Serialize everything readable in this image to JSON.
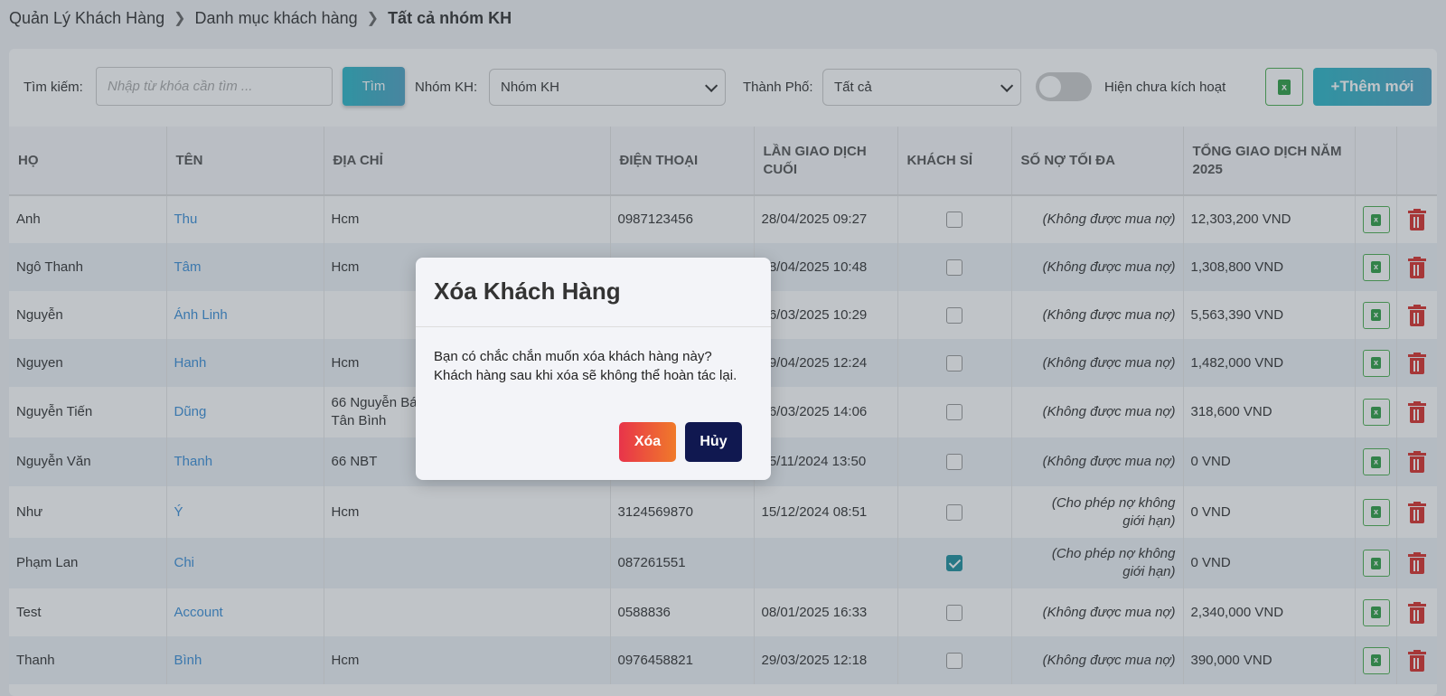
{
  "breadcrumb": {
    "items": [
      "Quản Lý Khách Hàng",
      "Danh mục khách hàng"
    ],
    "current": "Tất cả nhóm KH"
  },
  "filters": {
    "search_label": "Tìm kiếm:",
    "search_placeholder": "Nhập từ khóa cần tìm ...",
    "search_button": "Tìm",
    "group_label": "Nhóm KH:",
    "group_value": "Nhóm KH",
    "city_label": "Thành Phố:",
    "city_value": "Tất cả",
    "show_inactive_label": "Hiện chưa kích hoạt",
    "show_inactive_on": false,
    "add_button": "+Thêm mới"
  },
  "table": {
    "headers": [
      "HỌ",
      "TÊN",
      "ĐỊA CHỈ",
      "ĐIỆN THOẠI",
      "LẦN GIAO DỊCH CUỐI",
      "KHÁCH SỈ",
      "SỐ NỢ TỐI ĐA",
      "TỔNG GIAO DỊCH NĂM 2025",
      "",
      ""
    ],
    "rows": [
      {
        "ho": "Anh",
        "ten": "Thu",
        "dia_chi": "Hcm",
        "dien_thoai": "0987123456",
        "gd_cuoi": "28/04/2025 09:27",
        "khach_si": false,
        "no_toi_da": "(Không được mua nợ)",
        "tong_gd": "12,303,200 VND"
      },
      {
        "ho": "Ngô Thanh",
        "ten": "Tâm",
        "dia_chi": "Hcm",
        "dien_thoai": "",
        "gd_cuoi": "28/04/2025 10:48",
        "khach_si": false,
        "no_toi_da": "(Không được mua nợ)",
        "tong_gd": "1,308,800 VND"
      },
      {
        "ho": "Nguyễn",
        "ten": "Ánh Linh",
        "dia_chi": "",
        "dien_thoai": "",
        "gd_cuoi": "26/03/2025 10:29",
        "khach_si": false,
        "no_toi_da": "(Không được mua nợ)",
        "tong_gd": "5,563,390 VND"
      },
      {
        "ho": "Nguyen",
        "ten": "Hanh",
        "dia_chi": "Hcm",
        "dien_thoai": "",
        "gd_cuoi": "29/04/2025 12:24",
        "khach_si": false,
        "no_toi_da": "(Không được mua nợ)",
        "tong_gd": "1,482,000 VND"
      },
      {
        "ho": "Nguyễn Tiến",
        "ten": "Dũng",
        "dia_chi": "66 Nguyễn Bá\nTân Bình",
        "dien_thoai": "",
        "gd_cuoi": "26/03/2025 14:06",
        "khach_si": false,
        "no_toi_da": "(Không được mua nợ)",
        "tong_gd": "318,600 VND"
      },
      {
        "ho": "Nguyễn Văn",
        "ten": "Thanh",
        "dia_chi": "66 NBT",
        "dien_thoai": "",
        "gd_cuoi": "15/11/2024 13:50",
        "khach_si": false,
        "no_toi_da": "(Không được mua nợ)",
        "tong_gd": "0 VND"
      },
      {
        "ho": "Như",
        "ten": "Ý",
        "dia_chi": "Hcm",
        "dien_thoai": "3124569870",
        "gd_cuoi": "15/12/2024 08:51",
        "khach_si": false,
        "no_toi_da": "(Cho phép nợ không\ngiới hạn)",
        "tong_gd": "0 VND"
      },
      {
        "ho": "Phạm Lan",
        "ten": "Chi",
        "dia_chi": "",
        "dien_thoai": "087261551",
        "gd_cuoi": "",
        "khach_si": true,
        "no_toi_da": "(Cho phép nợ không\ngiới hạn)",
        "tong_gd": "0 VND"
      },
      {
        "ho": "Test",
        "ten": "Account",
        "dia_chi": "",
        "dien_thoai": "0588836",
        "gd_cuoi": "08/01/2025 16:33",
        "khach_si": false,
        "no_toi_da": "(Không được mua nợ)",
        "tong_gd": "2,340,000 VND"
      },
      {
        "ho": "Thanh",
        "ten": "Bình",
        "dia_chi": "Hcm",
        "dien_thoai": "0976458821",
        "gd_cuoi": "29/03/2025 12:18",
        "khach_si": false,
        "no_toi_da": "(Không được mua nợ)",
        "tong_gd": "390,000 VND"
      }
    ]
  },
  "modal": {
    "title": "Xóa Khách Hàng",
    "message_line1": "Bạn có chắc chắn muốn xóa khách hàng này?",
    "message_line2": "Khách hàng sau khi xóa sẽ không thể hoàn tác lại.",
    "confirm_button": "Xóa",
    "cancel_button": "Hủy"
  },
  "icons": {
    "excel": "excel-file-icon",
    "delete": "trash-icon",
    "dropdown": "chevron-down-icon"
  },
  "colors": {
    "accent": "#2cb7c7",
    "link": "#3b8fd8",
    "danger": "#d9302c",
    "excel": "#2e9e44",
    "cancel": "#101850"
  }
}
